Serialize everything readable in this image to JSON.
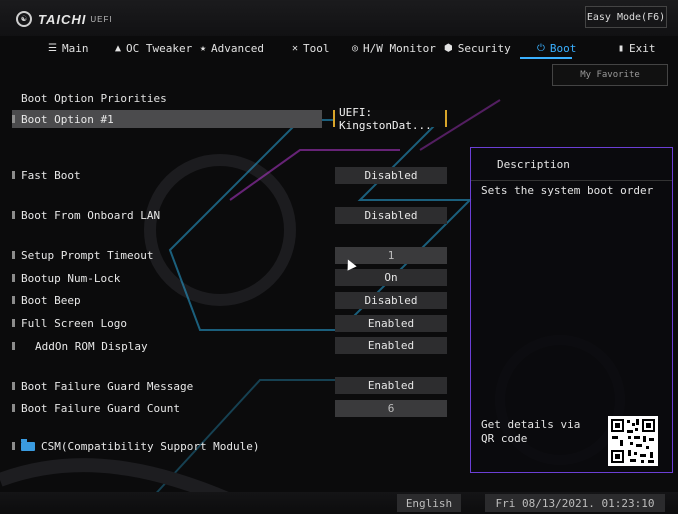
{
  "header": {
    "brand": "TAICHI",
    "brand_sub": "UEFI",
    "easy_mode": "Easy Mode(F6)"
  },
  "tabs": [
    {
      "label": "Main",
      "icon": "list-icon",
      "active": false
    },
    {
      "label": "OC Tweaker",
      "icon": "rocket-icon",
      "active": false
    },
    {
      "label": "Advanced",
      "icon": "star-icon",
      "active": false
    },
    {
      "label": "Tool",
      "icon": "tools-icon",
      "active": false
    },
    {
      "label": "H/W Monitor",
      "icon": "monitor-icon",
      "active": false
    },
    {
      "label": "Security",
      "icon": "shield-icon",
      "active": false
    },
    {
      "label": "Boot",
      "icon": "power-icon",
      "active": true
    },
    {
      "label": "Exit",
      "icon": "exit-icon",
      "active": false
    }
  ],
  "my_favorite": "My Favorite",
  "section_title": "Boot Option Priorities",
  "settings": [
    {
      "label": "Boot Option #1",
      "value": "UEFI: KingstonDat..."
    },
    {
      "label": "Fast Boot",
      "value": "Disabled"
    },
    {
      "label": "Boot From Onboard LAN",
      "value": "Disabled"
    },
    {
      "label": "Setup Prompt Timeout",
      "value": "1"
    },
    {
      "label": "Bootup Num-Lock",
      "value": "On"
    },
    {
      "label": "Boot Beep",
      "value": "Disabled"
    },
    {
      "label": "Full Screen Logo",
      "value": "Enabled"
    },
    {
      "label": "AddOn ROM Display",
      "value": "Enabled"
    },
    {
      "label": "Boot Failure Guard Message",
      "value": "Enabled"
    },
    {
      "label": "Boot Failure Guard Count",
      "value": "6"
    },
    {
      "label": "CSM(Compatibility Support Module)",
      "value": ""
    }
  ],
  "description": {
    "title": "Description",
    "text": "Sets the system boot order",
    "qr_text": "Get details via QR code"
  },
  "footer": {
    "language": "English",
    "datetime": "Fri 08/13/2021. 01:23:10"
  },
  "colors": {
    "accent": "#3ab0ff",
    "selection_border": "#d8a52a",
    "panel_border": "#6b3fd6"
  }
}
